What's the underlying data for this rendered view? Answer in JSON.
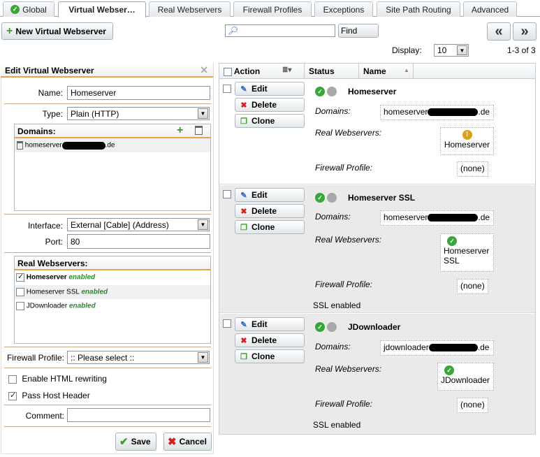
{
  "tabs": [
    "Global",
    "Virtual Webser…",
    "Real Webservers",
    "Firewall Profiles",
    "Exceptions",
    "Site Path Routing",
    "Advanced"
  ],
  "toolbar": {
    "new_label": "New Virtual Webserver",
    "search_value": "",
    "find_label": "Find",
    "display_label": "Display:",
    "display_value": "10",
    "range_text": "1-3 of 3",
    "prev": "«",
    "next": "»"
  },
  "edit": {
    "title": "Edit Virtual Webserver",
    "name_label": "Name:",
    "name_value": "Homeserver",
    "type_label": "Type:",
    "type_value": "Plain (HTTP)",
    "domains_label": "Domains:",
    "domain_prefix": "homeserver",
    "domain_suffix": "de",
    "interface_label": "Interface:",
    "interface_value": "External [Cable] (Address)",
    "port_label": "Port:",
    "port_value": "80",
    "real_label": "Real Webservers:",
    "real_items": [
      {
        "name": "Homeserver",
        "status": "enabled",
        "checked": true
      },
      {
        "name": "Homeserver SSL",
        "status": "enabled",
        "checked": false
      },
      {
        "name": "JDownloader",
        "status": "enabled",
        "checked": false
      }
    ],
    "fw_label": "Firewall Profile:",
    "fw_value": ":: Please select ::",
    "html_rewrite_label": "Enable HTML rewriting",
    "html_rewrite": false,
    "pass_host_label": "Pass Host Header",
    "pass_host": true,
    "comment_label": "Comment:",
    "comment_value": "",
    "save_label": "Save",
    "cancel_label": "Cancel"
  },
  "list": {
    "col_action": "Action",
    "col_status": "Status",
    "col_name": "Name",
    "btn_edit": "Edit",
    "btn_delete": "Delete",
    "btn_clone": "Clone",
    "domains_label": "Domains:",
    "real_label": "Real Webservers:",
    "fw_label": "Firewall Profile:",
    "rows": [
      {
        "name": "Homeserver",
        "domain_prefix": "homeserver",
        "domain_suffix": "de",
        "real": "Homeserver",
        "real_status": "warning",
        "fw": "(none)",
        "ssl": ""
      },
      {
        "name": "Homeserver SSL",
        "domain_prefix": "homeserver",
        "domain_suffix": "de",
        "real": "Homeserver SSL",
        "real_status": "ok",
        "fw": "(none)",
        "ssl": "SSL enabled"
      },
      {
        "name": "JDownloader",
        "domain_prefix": "jdownloader",
        "domain_suffix": "de",
        "real": "JDownloader",
        "real_status": "ok",
        "fw": "(none)",
        "ssl": "SSL enabled"
      }
    ]
  }
}
